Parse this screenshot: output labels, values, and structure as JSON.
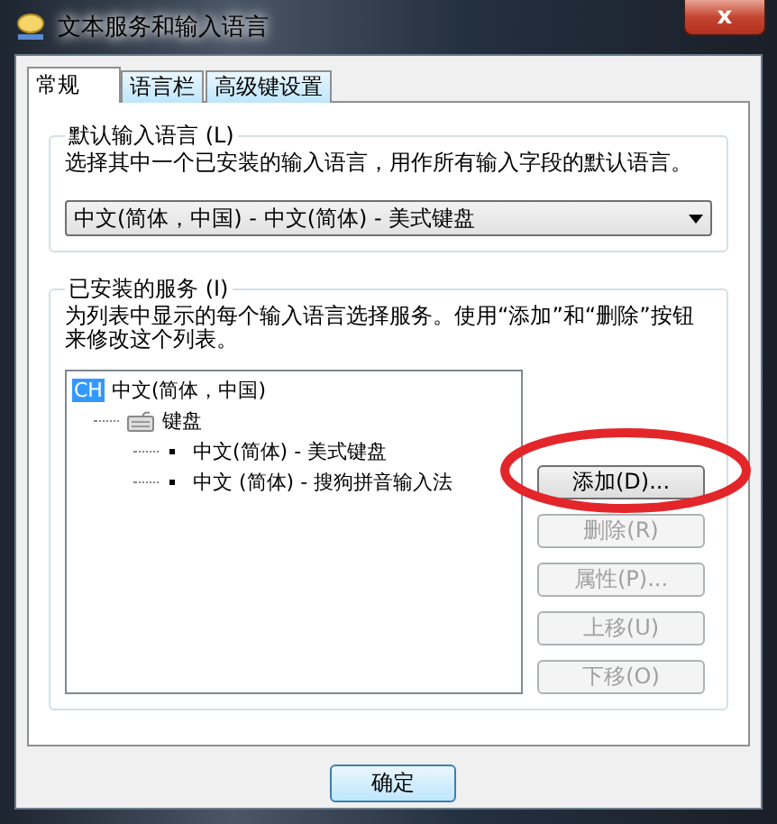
{
  "window": {
    "title": "文本服务和输入语言",
    "close": "x"
  },
  "tabs": [
    {
      "label": "常规",
      "selected": true
    },
    {
      "label": "语言栏",
      "selected": false
    },
    {
      "label": "高级键设置",
      "selected": false
    }
  ],
  "default_language": {
    "legend": "默认输入语言 (L)",
    "description": "选择其中一个已安装的输入语言，用作所有输入字段的默认语言。",
    "value": "中文(简体，中国) - 中文(简体) - 美式键盘"
  },
  "installed_services": {
    "legend": "已安装的服务 (I)",
    "description": "为列表中显示的每个输入语言选择服务。使用“添加”和“删除”按钮来修改这个列表。",
    "tree": [
      {
        "badge": "CH",
        "label": "中文(简体，中国)",
        "kind": "language",
        "children": [
          {
            "label": "键盘",
            "kind": "category",
            "children": [
              {
                "label": "中文(简体) - 美式键盘",
                "kind": "service"
              },
              {
                "label": "中文 (简体) - 搜狗拼音输入法",
                "kind": "service"
              }
            ]
          }
        ]
      }
    ],
    "buttons": [
      {
        "label": "添加(D)...",
        "disabled": false
      },
      {
        "label": "删除(R)",
        "disabled": true
      },
      {
        "label": "属性(P)...",
        "disabled": true
      },
      {
        "label": "上移(U)",
        "disabled": true
      },
      {
        "label": "下移(O)",
        "disabled": true
      }
    ]
  },
  "footer_buttons": [
    {
      "label": "确定",
      "default": true
    }
  ]
}
